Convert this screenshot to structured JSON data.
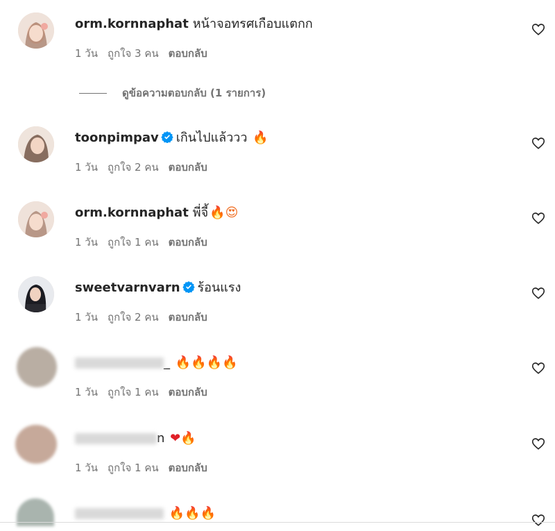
{
  "comments": [
    {
      "username": "orm.kornnaphat",
      "text": "หน้าจอทรศเกือบแตกก",
      "emojis": "",
      "verified": false,
      "time": "1 วัน",
      "likes": "ถูกใจ 3 คน",
      "reply": "ตอบกลับ"
    },
    {
      "username": "toonpimpav",
      "text": "เกินไปแล้ววว",
      "emojis": "🔥",
      "verified": true,
      "time": "1 วัน",
      "likes": "ถูกใจ 2 คน",
      "reply": "ตอบกลับ"
    },
    {
      "username": "orm.kornnaphat",
      "text": "พี่จี้",
      "emojis": "🔥😍",
      "verified": false,
      "time": "1 วัน",
      "likes": "ถูกใจ 1 คน",
      "reply": "ตอบกลับ"
    },
    {
      "username": "sweetvarnvarn",
      "text": "ร้อนแรง",
      "emojis": "",
      "verified": true,
      "time": "1 วัน",
      "likes": "ถูกใจ 2 คน",
      "reply": "ตอบกลับ"
    },
    {
      "username": "",
      "text": "_",
      "emojis": "🔥🔥🔥🔥",
      "verified": false,
      "time": "1 วัน",
      "likes": "ถูกใจ 1 คน",
      "reply": "ตอบกลับ"
    },
    {
      "username": "",
      "text": "n",
      "emojis": "❤🔥",
      "verified": false,
      "time": "1 วัน",
      "likes": "ถูกใจ 1 คน",
      "reply": "ตอบกลับ"
    },
    {
      "username": "",
      "text": "",
      "emojis": "🔥🔥🔥",
      "verified": false,
      "time": "",
      "likes": "",
      "reply": ""
    }
  ],
  "view_replies": "ดูข้อความตอบกลับ (1 รายการ)",
  "icons": {
    "like": "heart-outline-icon",
    "verified": "verified-badge-icon"
  },
  "colors": {
    "verified": "#0095f6",
    "meta": "#737373",
    "text": "#262626"
  }
}
